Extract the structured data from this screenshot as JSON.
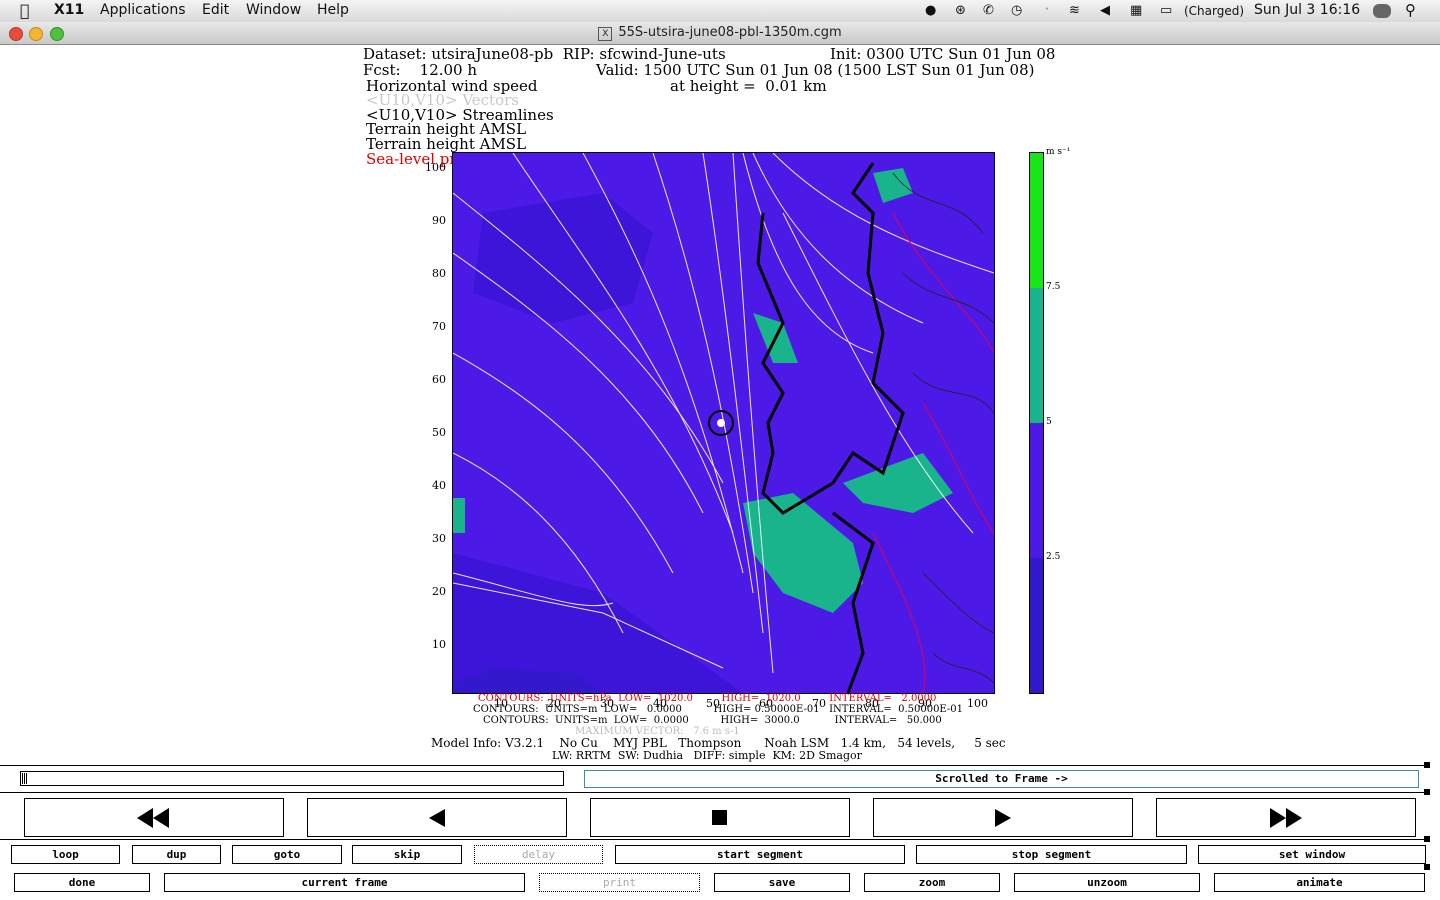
{
  "menubar": {
    "app": "X11",
    "items": [
      "Applications",
      "Edit",
      "Window",
      "Help"
    ],
    "battery": "(Charged)",
    "clock": "Sun Jul 3  16:16"
  },
  "window": {
    "title": "55S-utsira-june08-pbl-1350m.cgm"
  },
  "plot_header": {
    "dataset": "Dataset: utsiraJune08-pb  RIP: sfcwind-June-uts",
    "init": "Init: 0300 UTC Sun 01 Jun 08",
    "fcst": "Fcst:    12.00 h",
    "valid": "Valid: 1500 UTC Sun 01 Jun 08 (1500 LST Sun 01 Jun 08)",
    "field1": "Horizontal wind speed",
    "height": "at height =  0.01 km",
    "field2": "<U10,V10> Vectors",
    "field3": "<U10,V10> Streamlines",
    "field4": "Terrain height AMSL",
    "field5": "Terrain height AMSL",
    "field6": "Sea-level pressure"
  },
  "axes": {
    "y_ticks": [
      "100",
      "90",
      "80",
      "70",
      "60",
      "50",
      "40",
      "30",
      "20",
      "10"
    ],
    "x_ticks": [
      "10",
      "20",
      "30",
      "40",
      "50",
      "60",
      "70",
      "80",
      "90",
      "100"
    ]
  },
  "colorbar": {
    "unit": "m s⁻¹",
    "labels": [
      "7.5",
      "5",
      "2.5"
    ],
    "colors": [
      "#19e619",
      "#19b38c",
      "#4d19e6",
      "#3319cc"
    ]
  },
  "footer": {
    "contours1": "CONTOURS:  UNITS=hPa  LOW=  1020.0         HIGH=  1020.0         INTERVAL=   2.0000",
    "contours2": "CONTOURS:  UNITS=m  LOW=   0.0000          HIGH= 0.50000E-01   INTERVAL=  0.50000E-01",
    "contours3": "CONTOURS:  UNITS=m  LOW=  0.0000          HIGH=  3000.0           INTERVAL=   50.000",
    "maxvec": "MAXIMUM VECTOR:   7.6 m s-1",
    "model1": "Model Info: V3.2.1    No Cu    MYJ PBL   Thompson      Noah LSM   1.4 km,   54 levels,     5 sec",
    "model2": "LW: RRTM  SW: Dudhia   DIFF: simple  KM: 2D Smagor"
  },
  "controls": {
    "status": "Scrolled to Frame ->",
    "row1": [
      "loop",
      "dup",
      "goto",
      "skip",
      "delay",
      "start segment",
      "stop segment",
      "set window"
    ],
    "row2": [
      "done",
      "current frame",
      "print",
      "save",
      "zoom",
      "unzoom",
      "animate"
    ]
  }
}
